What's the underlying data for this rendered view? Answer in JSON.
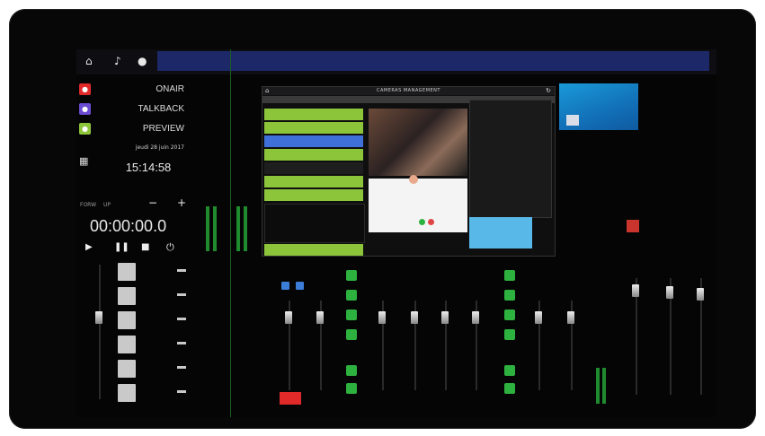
{
  "left_panel": {
    "onair": "ONAIR",
    "talkback": "TALKBACK",
    "preview": "PREVIEW",
    "date": "jeudi 28 juin 2017",
    "clock": "15:14:58",
    "timer": {
      "modes": [
        "FORW",
        "UP"
      ],
      "minus": "−",
      "plus": "+",
      "display": "00:00:00.0"
    }
  },
  "camera_panel": {
    "title": "CAMERAS MANAGEMENT"
  },
  "colors": {
    "onair": "#e02a2a",
    "talkback": "#6a4bd1",
    "preview": "#8cc43a",
    "accent_blue": "#1d2a6e",
    "green": "#2eb23f",
    "red": "#e02a2a"
  },
  "icons": {
    "home": "home-icon",
    "music": "music-icon",
    "mic": "mic-icon",
    "calendar": "calendar-icon",
    "refresh": "refresh-icon",
    "play": "play-icon",
    "pause": "pause-icon",
    "stop": "stop-icon",
    "power": "power-icon"
  }
}
